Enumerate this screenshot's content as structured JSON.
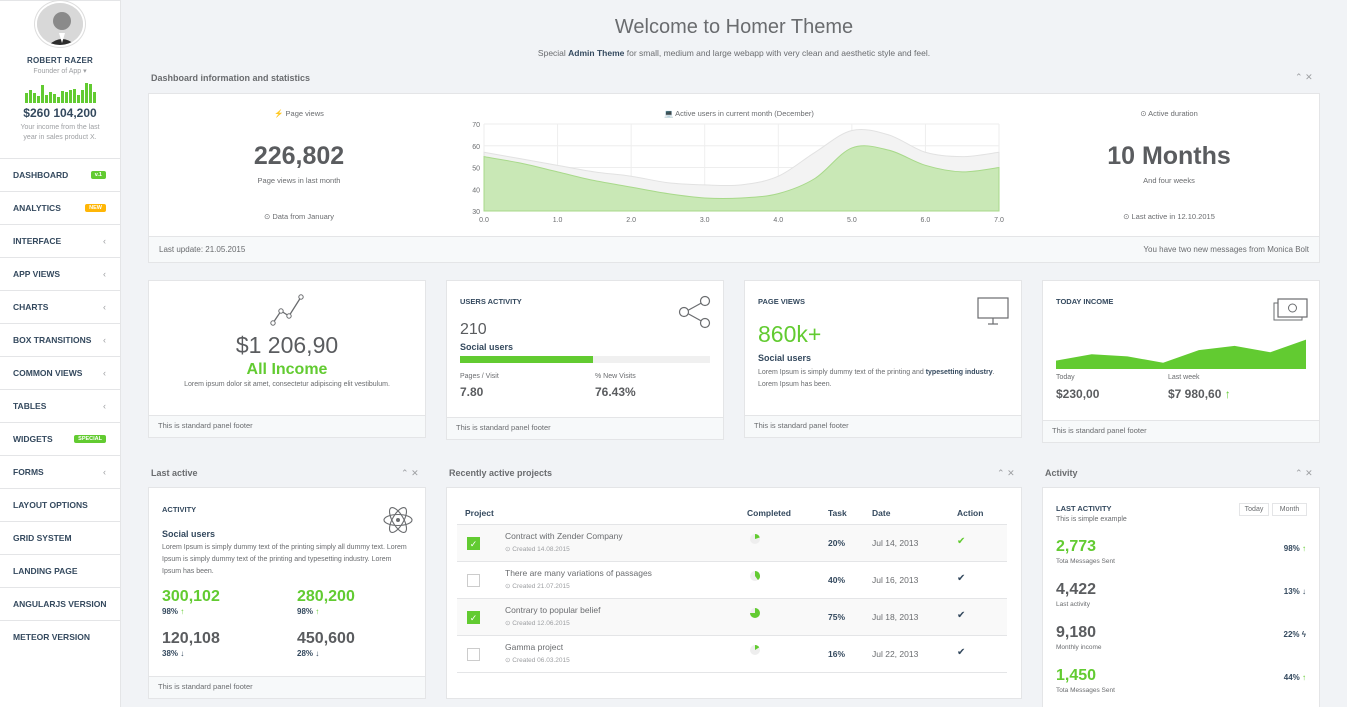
{
  "profile": {
    "name": "ROBERT RAZER",
    "role": "Founder of App ▾",
    "amount": "$260 104,200",
    "desc": "Your income from the last year in sales product X."
  },
  "spark_values": [
    0.45,
    0.6,
    0.45,
    0.3,
    0.8,
    0.35,
    0.5,
    0.4,
    0.25,
    0.55,
    0.5,
    0.6,
    0.65,
    0.35,
    0.6,
    0.9,
    0.85,
    0.5
  ],
  "nav": [
    {
      "label": "DASHBOARD",
      "badge": "v.1",
      "badge_color": "#62cb31"
    },
    {
      "label": "ANALYTICS",
      "badge": "NEW",
      "badge_color": "#ffb606"
    },
    {
      "label": "INTERFACE",
      "arrow": "‹"
    },
    {
      "label": "APP VIEWS",
      "arrow": "‹"
    },
    {
      "label": "CHARTS",
      "arrow": "‹"
    },
    {
      "label": "BOX TRANSITIONS",
      "arrow": "‹"
    },
    {
      "label": "COMMON VIEWS",
      "arrow": "‹"
    },
    {
      "label": "TABLES",
      "arrow": "‹"
    },
    {
      "label": "WIDGETS",
      "badge": "SPECIAL",
      "badge_color": "#62cb31"
    },
    {
      "label": "FORMS",
      "arrow": "‹"
    },
    {
      "label": "LAYOUT OPTIONS"
    },
    {
      "label": "GRID SYSTEM"
    },
    {
      "label": "LANDING PAGE"
    },
    {
      "label": "ANGULARJS VERSION"
    },
    {
      "label": "METEOR VERSION"
    }
  ],
  "header": {
    "title": "Welcome to Homer Theme",
    "subtitle_pre": "Special ",
    "subtitle_bold": "Admin Theme",
    "subtitle_post": " for small, medium and large webapp with very clean and aesthetic style and feel."
  },
  "stats": {
    "title": "Dashboard information and statistics",
    "pv_label": "⚡ Page views",
    "pv_value": "226,802",
    "pv_sub": "Page views in last month",
    "pv_foot": "⊙ Data from January",
    "chart_label": "💻 Active users in current month (December)",
    "ad_label": "⊙ Active duration",
    "ad_value": "10 Months",
    "ad_sub": "And four weeks",
    "ad_foot": "⊙ Last active in 12.10.2015",
    "footer_left": "Last update: 21.05.2015",
    "footer_right": "You have two new messages from Monica Bolt"
  },
  "chart_data": {
    "type": "area",
    "x": [
      0,
      0.5,
      1,
      1.5,
      2,
      2.5,
      3,
      3.5,
      4,
      4.5,
      5,
      5.5,
      6,
      6.5,
      7
    ],
    "series": [
      {
        "values": [
          55,
          52,
          48,
          44,
          41,
          38,
          36,
          36,
          38,
          45,
          59,
          58,
          51,
          48,
          50
        ]
      },
      {
        "values": [
          57,
          54,
          51,
          48,
          46,
          43,
          42,
          42,
          46,
          57,
          67,
          65,
          57,
          55,
          57
        ]
      }
    ],
    "xlim": [
      0,
      7
    ],
    "ylim": [
      30,
      70
    ],
    "xticks": [
      "0.0",
      "1.0",
      "2.0",
      "3.0",
      "4.0",
      "5.0",
      "6.0",
      "7.0"
    ],
    "yticks": [
      "70",
      "60",
      "50",
      "40",
      "30"
    ]
  },
  "cards": {
    "income": {
      "value": "$1 206,90",
      "label": "All Income",
      "desc": "Lorem ipsum dolor sit amet, consectetur adipiscing elit vestibulum.",
      "footer": "This is standard panel footer"
    },
    "users": {
      "title": "USERS ACTIVITY",
      "value": "210",
      "sub": "Social users",
      "progress": 0.53,
      "pv_label": "Pages / Visit",
      "pv_value": "7.80",
      "nv_label": "% New Visits",
      "nv_value": "76.43%",
      "footer": "This is standard panel footer"
    },
    "pageviews": {
      "title": "PAGE VIEWS",
      "value": "860k+",
      "sub": "Social users",
      "desc_pre": "Lorem Ipsum is simply dummy text of the printing and ",
      "desc_bold": "typesetting industry",
      "desc_post": ". Lorem Ipsum has been.",
      "footer": "This is standard panel footer"
    },
    "today": {
      "title": "TODAY INCOME",
      "today_label": "Today",
      "today_value": "$230,00",
      "week_label": "Last week",
      "week_value": "$7 980,60",
      "week_arrow": "↑",
      "footer": "This is standard panel footer",
      "spark": [
        0.2,
        0.35,
        0.3,
        0.15,
        0.45,
        0.55,
        0.4,
        0.7
      ]
    }
  },
  "last_active": {
    "title": "Last active",
    "section": "ACTIVITY",
    "sub": "Social users",
    "desc": "Lorem Ipsum is simply dummy text of the printing simply all dummy text. Lorem Ipsum is simply dummy text of the printing and typesetting industry. Lorem Ipsum has been.",
    "stats": [
      {
        "value": "300,102",
        "pct": "98%",
        "arrow": "↑",
        "green": true
      },
      {
        "value": "280,200",
        "pct": "98%",
        "arrow": "↑",
        "green": true
      },
      {
        "value": "120,108",
        "pct": "38%",
        "arrow": "↓",
        "green": false
      },
      {
        "value": "450,600",
        "pct": "28%",
        "arrow": "↓",
        "green": false
      }
    ],
    "footer": "This is standard panel footer"
  },
  "projects": {
    "title": "Recently active projects",
    "headers": [
      "Project",
      "Completed",
      "Task",
      "Date",
      "Action"
    ],
    "rows": [
      {
        "name": "Contract with Zender Company",
        "created": "⊙ Created 14.08.2015",
        "task": "20%",
        "date": "Jul 14, 2013",
        "checked": true,
        "pie": 0.2,
        "action_green": true
      },
      {
        "name": "There are many variations of passages",
        "created": "⊙ Created 21.07.2015",
        "task": "40%",
        "date": "Jul 16, 2013",
        "checked": false,
        "pie": 0.4,
        "action_green": false
      },
      {
        "name": "Contrary to popular belief",
        "created": "⊙ Created 12.06.2015",
        "task": "75%",
        "date": "Jul 18, 2013",
        "checked": true,
        "pie": 0.75,
        "action_green": false
      },
      {
        "name": "Gamma project",
        "created": "⊙ Created 06.03.2015",
        "task": "16%",
        "date": "Jul 22, 2013",
        "checked": false,
        "pie": 0.16,
        "action_green": false
      }
    ]
  },
  "activity": {
    "title": "Activity",
    "section": "LAST ACTIVITY",
    "sub": "This is simple example",
    "btn_today": "Today",
    "btn_month": "Month",
    "items": [
      {
        "value": "2,773",
        "label": "Tota Messages Sent",
        "pct": "98%",
        "arrow": "↑",
        "green": true
      },
      {
        "value": "4,422",
        "label": "Last activity",
        "pct": "13%",
        "arrow": "↓",
        "green": false
      },
      {
        "value": "9,180",
        "label": "Monthly income",
        "pct": "22%",
        "arrow": "ϟ",
        "green": false
      },
      {
        "value": "1,450",
        "label": "Tota Messages Sent",
        "pct": "44%",
        "arrow": "↑",
        "green": true
      }
    ]
  }
}
